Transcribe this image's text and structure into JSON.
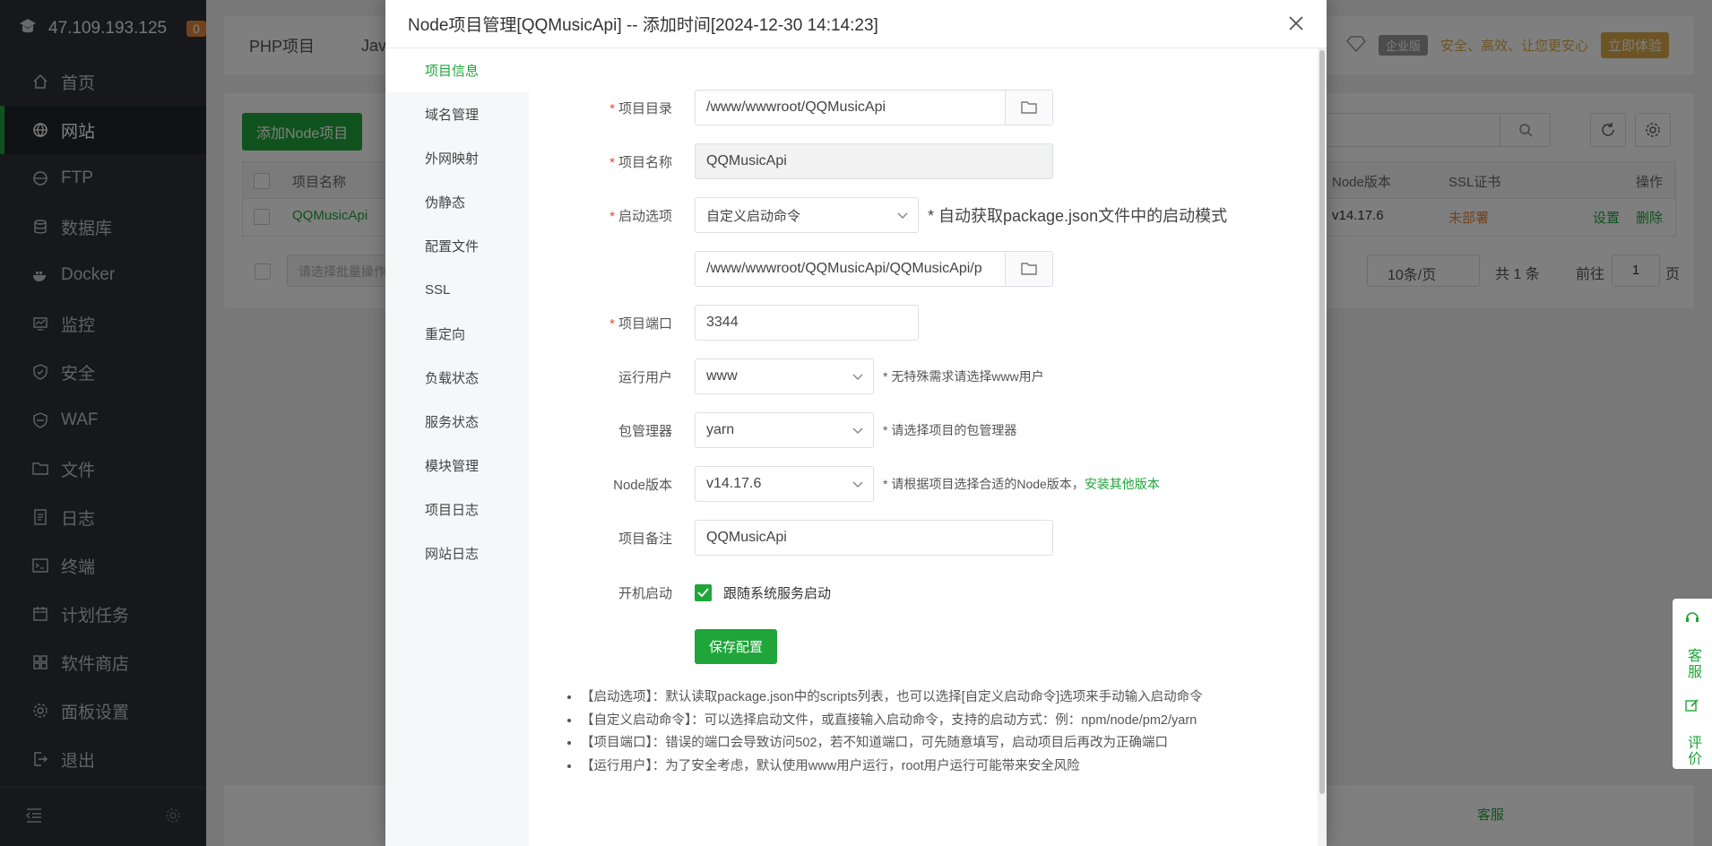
{
  "sidebar": {
    "server_ip": "47.109.193.125",
    "badge": "0",
    "items": [
      {
        "label": "首页",
        "icon": "home-icon",
        "active": false
      },
      {
        "label": "网站",
        "icon": "globe-icon",
        "active": true
      },
      {
        "label": "FTP",
        "icon": "ftp-icon",
        "active": false
      },
      {
        "label": "数据库",
        "icon": "database-icon",
        "active": false
      },
      {
        "label": "Docker",
        "icon": "docker-icon",
        "active": false
      },
      {
        "label": "监控",
        "icon": "monitor-icon",
        "active": false
      },
      {
        "label": "安全",
        "icon": "shield-icon",
        "active": false
      },
      {
        "label": "WAF",
        "icon": "waf-icon",
        "active": false
      },
      {
        "label": "文件",
        "icon": "folder-icon",
        "active": false
      },
      {
        "label": "日志",
        "icon": "log-icon",
        "active": false
      },
      {
        "label": "终端",
        "icon": "terminal-icon",
        "active": false
      },
      {
        "label": "计划任务",
        "icon": "calendar-icon",
        "active": false
      },
      {
        "label": "软件商店",
        "icon": "apps-icon",
        "active": false
      },
      {
        "label": "面板设置",
        "icon": "gear-icon",
        "active": false
      },
      {
        "label": "退出",
        "icon": "logout-icon",
        "active": false
      }
    ]
  },
  "background": {
    "tabs": [
      "PHP项目",
      "Java"
    ],
    "promo": {
      "edition": "企业版",
      "slogan": "安全、高效、让您更安心",
      "trial": "立即体验"
    },
    "add_button": "添加Node项目",
    "table": {
      "headers": {
        "name": "项目名称",
        "node_version": "Node版本",
        "ssl": "SSL证书",
        "ops": "操作"
      },
      "row": {
        "name": "QQMusicApi",
        "node_version": "v14.17.6",
        "ssl": "未部署",
        "settings": "设置",
        "delete": "删除"
      }
    },
    "batch_placeholder": "请选择批量操作",
    "pagination": {
      "per_page": "10条/页",
      "total": "共 1 条",
      "goto": "前往",
      "page": "1",
      "page_unit": "页"
    },
    "bottom_text": "客服"
  },
  "float_side": {
    "service": "客服",
    "rate": "评价"
  },
  "modal": {
    "title": "Node项目管理[QQMusicApi] -- 添加时间[2024-12-30 14:14:23]",
    "nav": [
      "项目信息",
      "域名管理",
      "外网映射",
      "伪静态",
      "配置文件",
      "SSL",
      "重定向",
      "负载状态",
      "服务状态",
      "模块管理",
      "项目日志",
      "网站日志"
    ],
    "form": {
      "dir_label": "项目目录",
      "dir_value": "/www/wwwroot/QQMusicApi",
      "name_label": "项目名称",
      "name_value": "QQMusicApi",
      "start_label": "启动选项",
      "start_value": "自定义启动命令",
      "start_hint": "* 自动获取package.json文件中的启动模式",
      "start_file_value": "/www/wwwroot/QQMusicApi/QQMusicApi/p",
      "port_label": "项目端口",
      "port_value": "3344",
      "user_label": "运行用户",
      "user_value": "www",
      "user_hint": "* 无特殊需求请选择www用户",
      "pm_label": "包管理器",
      "pm_value": "yarn",
      "pm_hint": "* 请选择项目的包管理器",
      "node_label": "Node版本",
      "node_value": "v14.17.6",
      "node_hint": "* 请根据项目选择合适的Node版本，",
      "node_link": "安装其他版本",
      "remark_label": "项目备注",
      "remark_value": "QQMusicApi",
      "boot_label": "开机启动",
      "boot_check_label": "跟随系统服务启动",
      "boot_checked": true,
      "save_button": "保存配置"
    },
    "notes": [
      "【启动选项】：默认读取package.json中的scripts列表，也可以选择[自定义启动命令]选项来手动输入启动命令",
      "【自定义启动命令】：可以选择启动文件，或直接输入启动命令，支持的启动方式：例：npm/node/pm2/yarn",
      "【项目端口】：错误的端口会导致访问502，若不知道端口，可先随意填写，启动项目后再改为正确端口",
      "【运行用户】：为了安全考虑，默认使用www用户运行，root用户运行可能带来安全风险"
    ]
  },
  "colors": {
    "accent": "#20a53a",
    "sidebar_bg": "#2c3136",
    "required": "#e8472c",
    "warn": "#e5843d",
    "gold": "#d9a84a"
  }
}
